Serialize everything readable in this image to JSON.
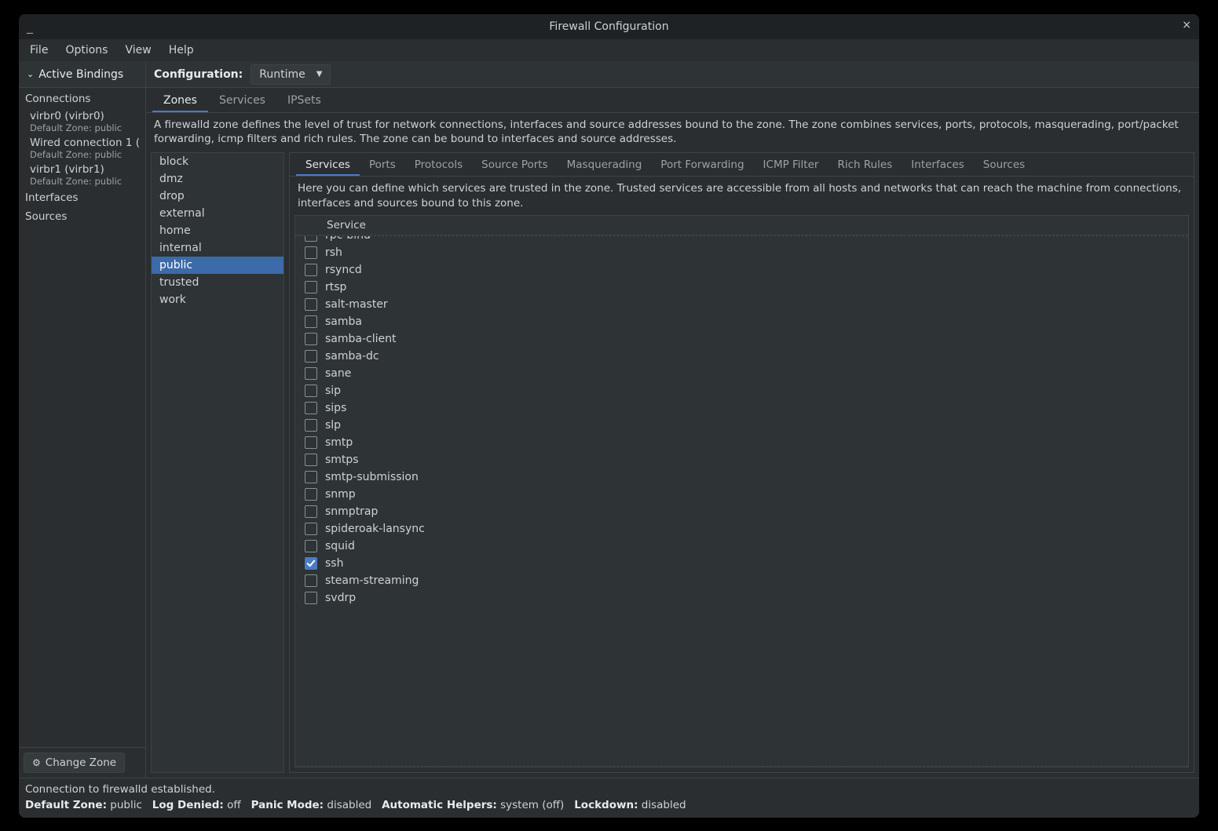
{
  "window": {
    "title": "Firewall Configuration"
  },
  "menubar": [
    "File",
    "Options",
    "View",
    "Help"
  ],
  "sidebar": {
    "header": "Active Bindings",
    "connections_label": "Connections",
    "connections": [
      {
        "name": "virbr0 (virbr0)",
        "sub": "Default Zone: public"
      },
      {
        "name": "Wired connection 1 (",
        "sub": "Default Zone: public"
      },
      {
        "name": "virbr1 (virbr1)",
        "sub": "Default Zone: public"
      }
    ],
    "extra_sections": [
      "Interfaces",
      "Sources"
    ],
    "change_zone_label": "Change Zone"
  },
  "config": {
    "label": "Configuration:",
    "value": "Runtime"
  },
  "main_tabs": [
    "Zones",
    "Services",
    "IPSets"
  ],
  "main_tab_active": 0,
  "zone_description": "A firewalld zone defines the level of trust for network connections, interfaces and source addresses bound to the zone. The zone combines services, ports, protocols, masquerading, port/packet forwarding, icmp filters and rich rules. The zone can be bound to interfaces and source addresses.",
  "zones": [
    "block",
    "dmz",
    "drop",
    "external",
    "home",
    "internal",
    "public",
    "trusted",
    "work"
  ],
  "zone_selected": "public",
  "sub_tabs": [
    "Services",
    "Ports",
    "Protocols",
    "Source Ports",
    "Masquerading",
    "Port Forwarding",
    "ICMP Filter",
    "Rich Rules",
    "Interfaces",
    "Sources"
  ],
  "sub_tab_active": 0,
  "services_description": "Here you can define which services are trusted in the zone. Trusted services are accessible from all hosts and networks that can reach the machine from connections, interfaces and sources bound to this zone.",
  "services_header": "Service",
  "services": [
    {
      "name": "rpc-bind",
      "checked": false,
      "clipped": true
    },
    {
      "name": "rsh",
      "checked": false
    },
    {
      "name": "rsyncd",
      "checked": false
    },
    {
      "name": "rtsp",
      "checked": false
    },
    {
      "name": "salt-master",
      "checked": false
    },
    {
      "name": "samba",
      "checked": false
    },
    {
      "name": "samba-client",
      "checked": false
    },
    {
      "name": "samba-dc",
      "checked": false
    },
    {
      "name": "sane",
      "checked": false
    },
    {
      "name": "sip",
      "checked": false
    },
    {
      "name": "sips",
      "checked": false
    },
    {
      "name": "slp",
      "checked": false
    },
    {
      "name": "smtp",
      "checked": false
    },
    {
      "name": "smtps",
      "checked": false
    },
    {
      "name": "smtp-submission",
      "checked": false
    },
    {
      "name": "snmp",
      "checked": false
    },
    {
      "name": "snmptrap",
      "checked": false
    },
    {
      "name": "spideroak-lansync",
      "checked": false
    },
    {
      "name": "squid",
      "checked": false
    },
    {
      "name": "ssh",
      "checked": true
    },
    {
      "name": "steam-streaming",
      "checked": false
    },
    {
      "name": "svdrp",
      "checked": false
    }
  ],
  "status": {
    "line1": "Connection to firewalld established.",
    "default_zone_label": "Default Zone:",
    "default_zone": "public",
    "log_denied_label": "Log Denied:",
    "log_denied": "off",
    "panic_label": "Panic Mode:",
    "panic": "disabled",
    "auto_helpers_label": "Automatic Helpers:",
    "auto_helpers": "system (off)",
    "lockdown_label": "Lockdown:",
    "lockdown": "disabled"
  }
}
